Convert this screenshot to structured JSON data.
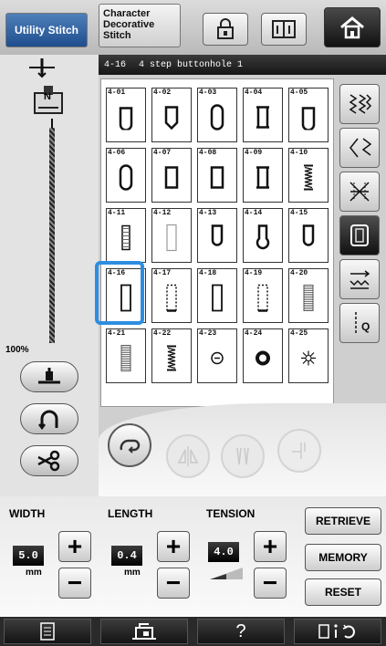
{
  "colors": {
    "accent": "#2d8ee0",
    "tab_active": "#2a5c9c",
    "header": "#1c1c1c"
  },
  "tabs": {
    "utility": "Utility Stitch",
    "character": "Character\nDecorative\nStitch"
  },
  "header": {
    "code": "4-16",
    "title": "4 step buttonhole 1"
  },
  "presser_foot": "N",
  "zoom": "100%",
  "stitches": [
    {
      "code": "4-01",
      "glyph": "buttonhole-rounded"
    },
    {
      "code": "4-02",
      "glyph": "buttonhole-pointed"
    },
    {
      "code": "4-03",
      "glyph": "buttonhole-oval"
    },
    {
      "code": "4-04",
      "glyph": "buttonhole-bartack"
    },
    {
      "code": "4-05",
      "glyph": "buttonhole-rounded"
    },
    {
      "code": "4-06",
      "glyph": "buttonhole-oval"
    },
    {
      "code": "4-07",
      "glyph": "buttonhole-square"
    },
    {
      "code": "4-08",
      "glyph": "buttonhole-square"
    },
    {
      "code": "4-09",
      "glyph": "buttonhole-bartack"
    },
    {
      "code": "4-10",
      "glyph": "buttonhole-zigzag"
    },
    {
      "code": "4-11",
      "glyph": "buttonhole-stretch"
    },
    {
      "code": "4-12",
      "glyph": "buttonhole-light"
    },
    {
      "code": "4-13",
      "glyph": "buttonhole-keyhole"
    },
    {
      "code": "4-14",
      "glyph": "buttonhole-keyhole-round"
    },
    {
      "code": "4-15",
      "glyph": "buttonhole-keyhole"
    },
    {
      "code": "4-16",
      "glyph": "buttonhole-4step"
    },
    {
      "code": "4-17",
      "glyph": "buttonhole-4step-dotted"
    },
    {
      "code": "4-18",
      "glyph": "buttonhole-4step"
    },
    {
      "code": "4-19",
      "glyph": "buttonhole-4step-dotted"
    },
    {
      "code": "4-20",
      "glyph": "buttonhole-dense"
    },
    {
      "code": "4-21",
      "glyph": "buttonhole-dense"
    },
    {
      "code": "4-22",
      "glyph": "buttonhole-zigzag"
    },
    {
      "code": "4-23",
      "glyph": "eyelet-small"
    },
    {
      "code": "4-24",
      "glyph": "eyelet-ring"
    },
    {
      "code": "4-25",
      "glyph": "eyelet-star"
    }
  ],
  "settings": {
    "width": {
      "label": "WIDTH",
      "value": "5.0",
      "unit": "mm"
    },
    "length": {
      "label": "LENGTH",
      "value": "0.4",
      "unit": "mm"
    },
    "tension": {
      "label": "TENSION",
      "value": "4.0"
    },
    "plus": "+",
    "minus": "−"
  },
  "actions": {
    "retrieve": "RETRIEVE",
    "memory": "MEMORY",
    "reset": "RESET"
  },
  "bottom": {
    "help": "?"
  }
}
